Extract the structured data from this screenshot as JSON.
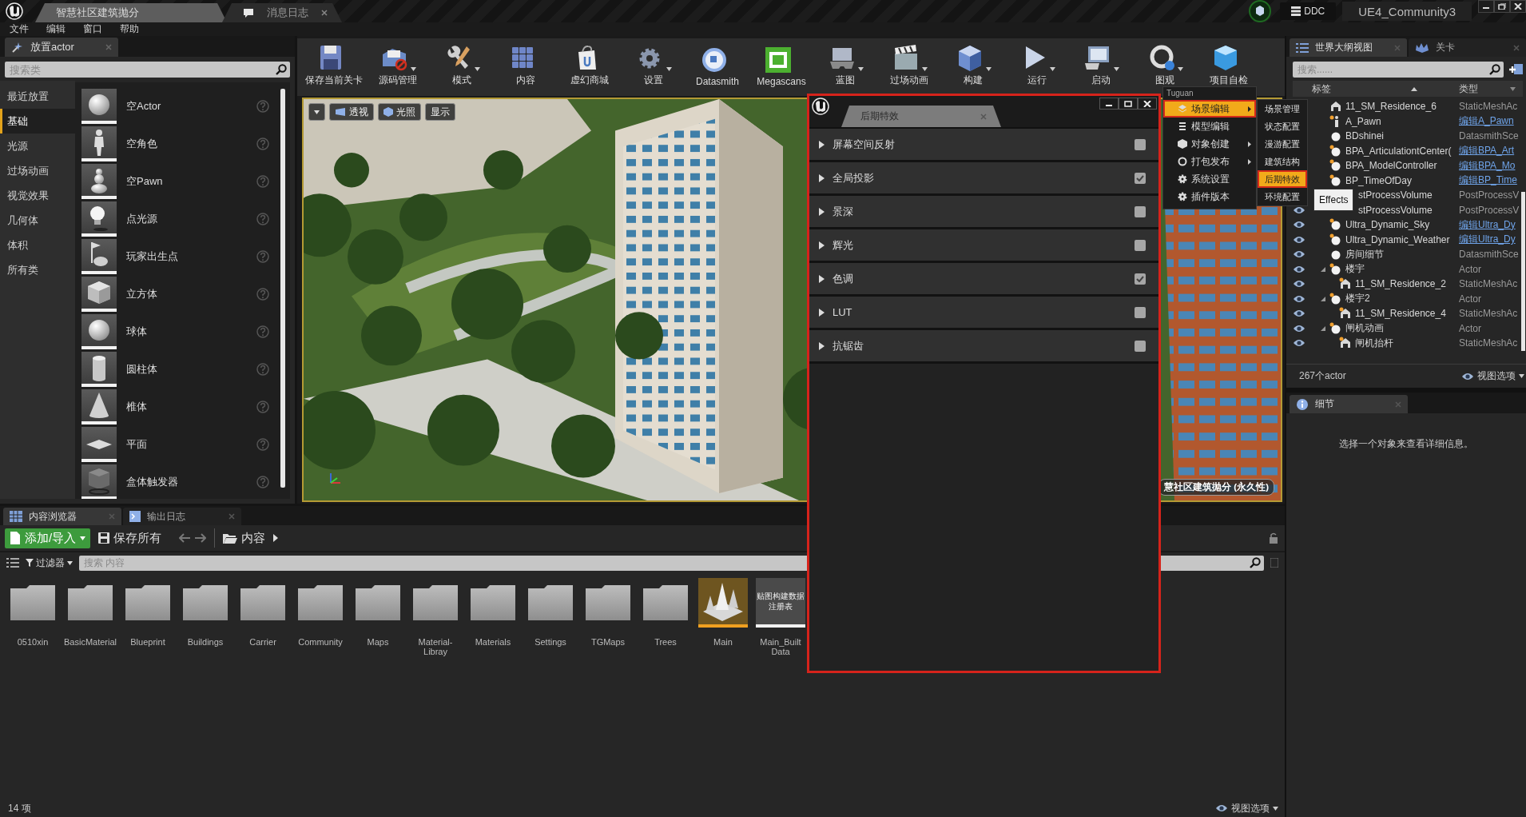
{
  "title_bar": {
    "tabs": [
      {
        "label": "智慧社区建筑抛分",
        "kind": "level",
        "selected": true
      },
      {
        "label": "消息日志",
        "kind": "log",
        "selected": false
      }
    ],
    "ddc_button": "DDC",
    "project_name": "UE4_Community3"
  },
  "menu_bar": [
    "文件",
    "编辑",
    "窗口",
    "帮助"
  ],
  "place_actors": {
    "tab": "放置actor",
    "search": {
      "placeholder": "搜索类"
    },
    "categories": [
      {
        "label": "最近放置",
        "selected": false
      },
      {
        "label": "基础",
        "selected": true
      },
      {
        "label": "光源",
        "selected": false
      },
      {
        "label": "过场动画",
        "selected": false
      },
      {
        "label": "视觉效果",
        "selected": false
      },
      {
        "label": "几何体",
        "selected": false
      },
      {
        "label": "体积",
        "selected": false
      },
      {
        "label": "所有类",
        "selected": false
      }
    ],
    "items": [
      {
        "label": "空Actor",
        "kind": "sphere"
      },
      {
        "label": "空角色",
        "kind": "character"
      },
      {
        "label": "空Pawn",
        "kind": "pawn"
      },
      {
        "label": "点光源",
        "kind": "light"
      },
      {
        "label": "玩家出生点",
        "kind": "playerstart"
      },
      {
        "label": "立方体",
        "kind": "cube"
      },
      {
        "label": "球体",
        "kind": "sphere"
      },
      {
        "label": "圆柱体",
        "kind": "cylinder"
      },
      {
        "label": "椎体",
        "kind": "cone"
      },
      {
        "label": "平面",
        "kind": "plane"
      },
      {
        "label": "盒体触发器",
        "kind": "trigger"
      }
    ]
  },
  "toolbar": [
    {
      "label": "保存当前关卡",
      "kind": "save",
      "dropdown": false
    },
    {
      "label": "源码管理",
      "kind": "source",
      "dropdown": true
    },
    {
      "label": "模式",
      "kind": "modes",
      "dropdown": true
    },
    {
      "label": "内容",
      "kind": "content",
      "dropdown": false
    },
    {
      "label": "虚幻商城",
      "kind": "market",
      "dropdown": false
    },
    {
      "label": "设置",
      "kind": "settings",
      "dropdown": true
    },
    {
      "label": "Datasmith",
      "kind": "datasmith",
      "dropdown": false
    },
    {
      "label": "Megascans",
      "kind": "megascans",
      "dropdown": false
    },
    {
      "label": "蓝图",
      "kind": "blueprint",
      "dropdown": true
    },
    {
      "label": "过场动画",
      "kind": "cinematic",
      "dropdown": true
    },
    {
      "label": "构建",
      "kind": "build",
      "dropdown": true
    },
    {
      "label": "运行",
      "kind": "play",
      "dropdown": true
    },
    {
      "label": "启动",
      "kind": "launch",
      "dropdown": true
    },
    {
      "label": "图观",
      "kind": "tuguan",
      "dropdown": true
    },
    {
      "label": "项目自检",
      "kind": "check",
      "dropdown": false
    }
  ],
  "viewport": {
    "buttons": [
      {
        "label": "透视",
        "kind": "perspective"
      },
      {
        "label": "光照",
        "kind": "lit"
      },
      {
        "label": "显示",
        "kind": "show"
      }
    ],
    "level_label": "慧社区建筑抛分 (永久性)"
  },
  "effects_window": {
    "tab": "后期特效",
    "rows": [
      {
        "label": "屏幕空间反射",
        "checked": false
      },
      {
        "label": "全局投影",
        "checked": true
      },
      {
        "label": "景深",
        "checked": false
      },
      {
        "label": "辉光",
        "checked": false
      },
      {
        "label": "色调",
        "checked": true
      },
      {
        "label": "LUT",
        "checked": false
      },
      {
        "label": "抗锯齿",
        "checked": false
      }
    ]
  },
  "tuguan_menu": {
    "header": "Tuguan",
    "items": [
      {
        "label": "场景编辑",
        "kind": "layers",
        "submenu": true,
        "selected": true
      },
      {
        "label": "模型编辑",
        "kind": "list",
        "submenu": false,
        "selected": false
      },
      {
        "label": "对象创建",
        "kind": "cube",
        "submenu": true,
        "selected": false
      },
      {
        "label": "打包发布",
        "kind": "ring",
        "submenu": true,
        "selected": false
      },
      {
        "label": "系统设置",
        "kind": "gear",
        "submenu": false,
        "selected": false
      },
      {
        "label": "插件版本",
        "kind": "gear",
        "submenu": false,
        "selected": false
      }
    ],
    "submenu": [
      {
        "label": "场景管理",
        "selected": false
      },
      {
        "label": "状态配置",
        "selected": false
      },
      {
        "label": "漫游配置",
        "selected": false
      },
      {
        "label": "建筑结构",
        "selected": false
      },
      {
        "label": "后期特效",
        "selected": true
      },
      {
        "label": "环境配置",
        "selected": false
      }
    ],
    "tooltip": "Effects"
  },
  "outliner": {
    "tabs": [
      {
        "label": "世界大纲视图",
        "kind": "outline",
        "selected": true
      },
      {
        "label": "关卡",
        "kind": "levels",
        "selected": false
      }
    ],
    "search": {
      "placeholder": "搜索......"
    },
    "columns": [
      "标签",
      "类型"
    ],
    "rows": [
      {
        "name": "11_SM_Residence_6",
        "kind": "mesh",
        "eye_visible": false,
        "type": {
          "text": "StaticMeshAc",
          "link": false
        }
      },
      {
        "name": "A_Pawn",
        "kind": "pawn",
        "eye_visible": false,
        "type": {
          "text": "编辑A_Pawn",
          "link": true
        }
      },
      {
        "name": "BDshinei",
        "kind": "actor",
        "eye_visible": false,
        "type": {
          "text": "DatasmithSce",
          "link": false
        }
      },
      {
        "name": "BPA_ArticulationtCenter(",
        "kind": "blueprint",
        "eye_visible": false,
        "type": {
          "text": "编辑BPA_Art",
          "link": true
        }
      },
      {
        "name": "BPA_ModelController",
        "kind": "blueprint",
        "eye_visible": false,
        "type": {
          "text": "编辑BPA_Mo",
          "link": true
        }
      },
      {
        "name": "BP_TimeOfDay",
        "kind": "blueprint",
        "eye_visible": false,
        "type": {
          "text": "编辑BP_Time",
          "link": true
        }
      },
      {
        "name": "stProcessVolume",
        "kind": "hidden",
        "eye_visible": false,
        "type": {
          "text": "PostProcessV",
          "link": false
        }
      },
      {
        "name": "stProcessVolume",
        "kind": "hidden",
        "eye_visible": true,
        "type": {
          "text": "PostProcessV",
          "link": false
        }
      },
      {
        "name": "Ultra_Dynamic_Sky",
        "kind": "blueprint",
        "eye_visible": true,
        "type": {
          "text": "编辑Ultra_Dy",
          "link": true
        }
      },
      {
        "name": "Ultra_Dynamic_Weather",
        "kind": "blueprint",
        "eye_visible": true,
        "type": {
          "text": "编辑Ultra_Dy",
          "link": true
        }
      },
      {
        "name": "房间细节",
        "kind": "actor",
        "eye_visible": true,
        "type": {
          "text": "DatasmithSce",
          "link": false
        }
      },
      {
        "name": "楼宇",
        "kind": "blueprint",
        "eye_visible": true,
        "expanded": true,
        "type": {
          "text": "Actor",
          "link": false
        },
        "children": [
          {
            "name": "11_SM_Residence_2",
            "kind": "mesh_blueprint",
            "eye_visible": true,
            "type": {
              "text": "StaticMeshAc",
              "link": false
            }
          }
        ]
      },
      {
        "name": "楼宇2",
        "kind": "blueprint",
        "eye_visible": true,
        "expanded": true,
        "type": {
          "text": "Actor",
          "link": false
        },
        "children": [
          {
            "name": "11_SM_Residence_4",
            "kind": "mesh_blueprint",
            "eye_visible": true,
            "type": {
              "text": "StaticMeshAc",
              "link": false
            }
          }
        ]
      },
      {
        "name": "闸机动画",
        "kind": "blueprint",
        "eye_visible": true,
        "expanded": true,
        "type": {
          "text": "Actor",
          "link": false
        },
        "children": [
          {
            "name": "闸机抬杆",
            "kind": "mesh_blueprint",
            "eye_visible": true,
            "type": {
              "text": "StaticMeshAc",
              "link": false
            }
          }
        ]
      }
    ],
    "count": "267个actor",
    "view_options": "视图选项"
  },
  "details": {
    "tab": "细节",
    "message": "选择一个对象来查看详细信息。"
  },
  "content_browser": {
    "tabs": [
      {
        "label": "内容浏览器",
        "kind": "browser",
        "selected": true
      },
      {
        "label": "输出日志",
        "kind": "log",
        "selected": false
      }
    ],
    "add_button": "添加/导入",
    "save_all": "保存所有",
    "path": "内容",
    "filter": "过滤器",
    "search": {
      "placeholder": "搜索 内容"
    },
    "assets": [
      {
        "label": "0510xin",
        "kind": "folder"
      },
      {
        "label": "BasicMaterial",
        "kind": "folder"
      },
      {
        "label": "Blueprint",
        "kind": "folder"
      },
      {
        "label": "Buildings",
        "kind": "folder"
      },
      {
        "label": "Carrier",
        "kind": "folder"
      },
      {
        "label": "Community",
        "kind": "folder"
      },
      {
        "label": "Maps",
        "kind": "folder"
      },
      {
        "label": "Material-Libray",
        "kind": "folder"
      },
      {
        "label": "Materials",
        "kind": "folder"
      },
      {
        "label": "Settings",
        "kind": "folder"
      },
      {
        "label": "TGMaps",
        "kind": "folder"
      },
      {
        "label": "Trees",
        "kind": "folder"
      },
      {
        "label": "Main",
        "kind": "map"
      },
      {
        "label": "Main_BuiltData",
        "kind": "data",
        "thumbnail_text": "贴图构建数据注册表"
      }
    ],
    "item_count": "14 项",
    "view_options": "视图选项"
  }
}
